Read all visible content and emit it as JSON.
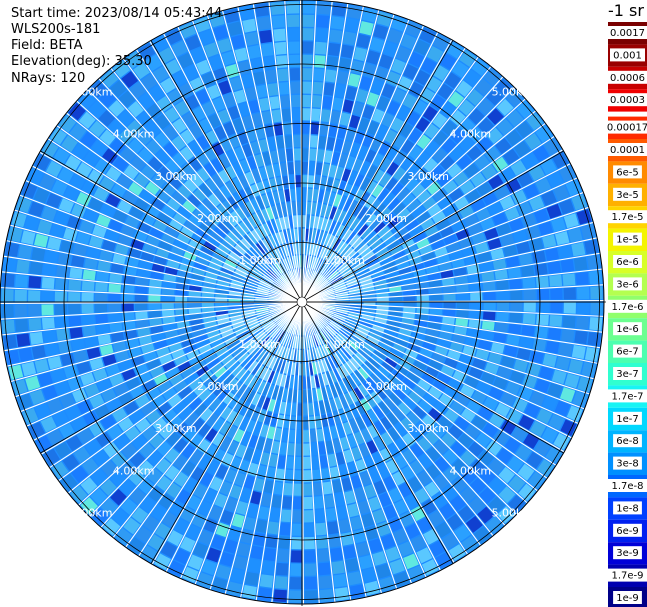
{
  "info": {
    "start_time": "Start time: 2023/08/14 05:43:44",
    "instrument": "WLS200s-181",
    "field": "Field: BETA",
    "elevation": "Elevation(deg): 35.30",
    "nrays": "NRays: 120"
  },
  "colorbar": {
    "unit_title": "-1 sr",
    "labels": [
      "0.0017",
      "0.001",
      "0.0006",
      "0.0003",
      "0.00017",
      "0.0001",
      "6e-5",
      "3e-5",
      "1.7e-5",
      "1e-5",
      "6e-6",
      "3e-6",
      "1.7e-6",
      "1e-6",
      "6e-7",
      "3e-7",
      "1.7e-7",
      "1e-7",
      "6e-8",
      "3e-8",
      "1.7e-8",
      "1e-8",
      "6e-9",
      "3e-9",
      "1.7e-9",
      "1e-9"
    ],
    "colors": [
      "#7a0000",
      "#990000",
      "#c80000",
      "#f00000",
      "#ff2a00",
      "#ff5a00",
      "#ff8a00",
      "#ffb000",
      "#ffd400",
      "#f4f400",
      "#d8ff28",
      "#b4ff50",
      "#90ff6c",
      "#6cff90",
      "#4cffb0",
      "#30ffd0",
      "#18f4f4",
      "#00d8ff",
      "#00b4ff",
      "#0090ff",
      "#0068ff",
      "#0040ff",
      "#0020f0",
      "#0000d8",
      "#0000b0",
      "#000088"
    ]
  },
  "chart_data": {
    "type": "heatmap",
    "projection": "polar (PPI scan)",
    "rays": 120,
    "range_rings_km": [
      1,
      2,
      3,
      4,
      5
    ],
    "ring_labels": [
      "1.00km",
      "2.00km",
      "3.00km",
      "4.00km",
      "5.00km"
    ],
    "field": "BETA",
    "colormap": "jet",
    "dominant_value": "~1e-8 to 6e-8 sr-1",
    "grid": true
  }
}
